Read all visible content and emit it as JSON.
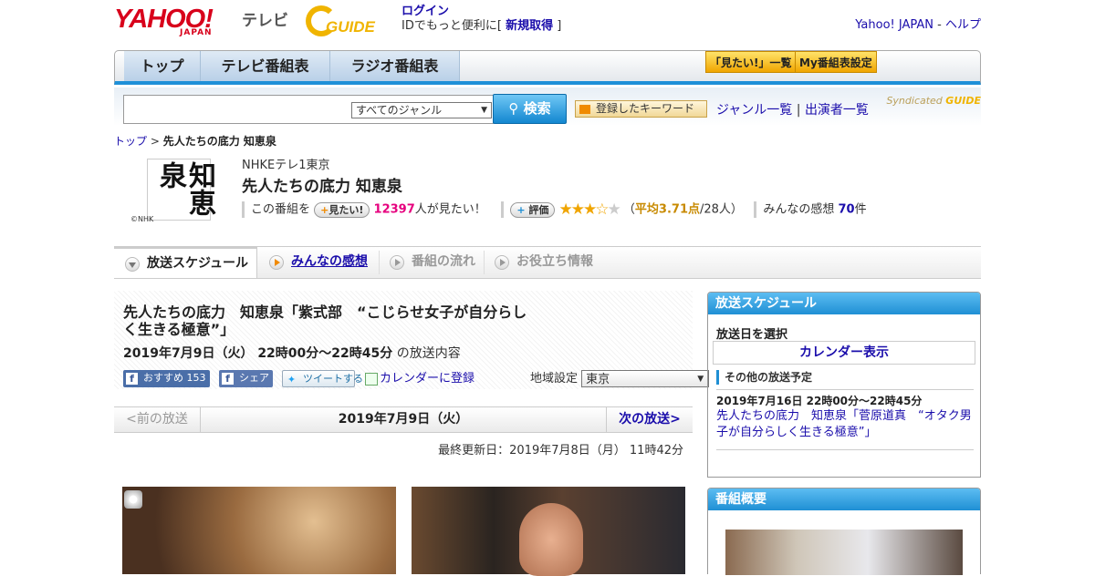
{
  "header": {
    "logo_text": "YAHOO!",
    "logo_sub": "JAPAN",
    "tv_label": "テレビ",
    "gguide_text": "GUIDE",
    "login_link": "ログイン",
    "login_desc": "IDでもっと便利に[",
    "signup_link": "新規取得",
    "signup_end": "]",
    "yahoo_japan_link": "Yahoo! JAPAN",
    "separator": "-",
    "help_link": "ヘルプ"
  },
  "nav": {
    "tabs": [
      {
        "label": "トップ"
      },
      {
        "label": "テレビ番組表"
      },
      {
        "label": "ラジオ番組表"
      }
    ],
    "watchlist_button": "「見たい!」一覧",
    "my_schedule_button": "My番組表設定"
  },
  "search": {
    "placeholder": "",
    "genre_select": "すべてのジャンル",
    "search_button": "検索",
    "keyword_button": "登録したキーワード",
    "genre_list_link": "ジャンル一覧",
    "divider": "|",
    "performer_list_link": "出演者一覧",
    "syndicated_label": "Syndicated"
  },
  "breadcrumb": {
    "top_link": "トップ",
    "sep": ">",
    "current": "先人たちの底力 知恵泉"
  },
  "program": {
    "thumb_kanji": "知恵泉",
    "nhk_mark": "©NHK",
    "station": "NHKEテレ1東京",
    "title": "先人たちの底力 知恵泉",
    "want_prefix": "この番組を",
    "want_button": "見たい!",
    "want_count": "12397",
    "want_suffix": "人が見たい！",
    "rating_button": "評価",
    "rating_value": 3.71,
    "rating_max": 5,
    "rating_open": "（",
    "rating_avg": "平均3.71点",
    "rating_count": "/28人）",
    "impressions_label": "みんなの感想",
    "impressions_count": "70",
    "impressions_unit": "件"
  },
  "subtabs": [
    {
      "label": "放送スケジュール"
    },
    {
      "label": "みんなの感想"
    },
    {
      "label": "番組の流れ"
    },
    {
      "label": "お役立ち情報"
    }
  ],
  "episode": {
    "title": "先人たちの底力　知恵泉「紫式部　“こじらせ女子が自分らしく生きる極意”」",
    "datetime": "2019年7月9日（火） 22時00分～22時45分",
    "datetime_suffix": "の放送内容",
    "fb_recommend": "おすすめ",
    "fb_count": "153",
    "fb_share": "シェア",
    "tweet": "ツイートする",
    "calendar_register": "カレンダーに登録",
    "region_label": "地域設定",
    "region_value": "東京",
    "prev": "<前の放送",
    "current_date": "2019年7月9日（火）",
    "next": "次の放送>",
    "updated": "最終更新日：2019年7月8日（月） 11時42分"
  },
  "sidebar": {
    "schedule_title": "放送スケジュール",
    "select_date": "放送日を選択",
    "calendar_link": "カレンダー表示",
    "other_label": "その他の放送予定",
    "other_datetime": "2019年7月16日 22時00分～22時45分",
    "other_title": "先人たちの底力　知恵泉「菅原道真　“オタク男子が自分らしく生きる極意”」",
    "overview_title": "番組概要"
  },
  "colors": {
    "accent": "#1f8fd4",
    "brand_red": "#d8001b",
    "gguide_yellow": "#f0b400",
    "count_pink": "#e6007e",
    "star": "#f0a500"
  }
}
